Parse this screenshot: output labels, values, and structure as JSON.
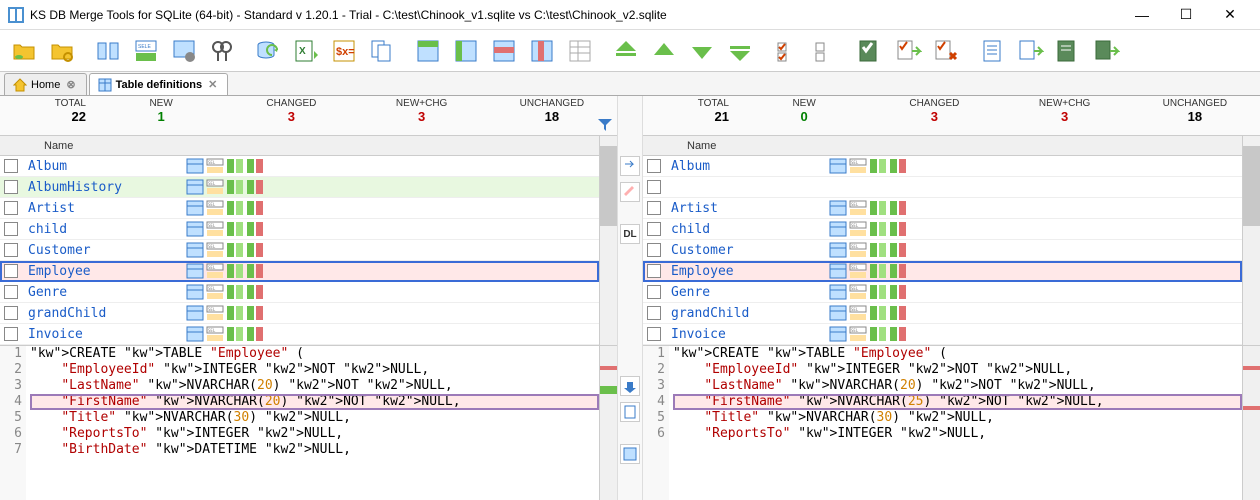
{
  "window": {
    "title": "KS DB Merge Tools for SQLite (64-bit) - Standard v 1.20.1 - Trial - C:\\test\\Chinook_v1.sqlite vs C:\\test\\Chinook_v2.sqlite"
  },
  "tabs": {
    "home": "Home",
    "active": "Table definitions"
  },
  "summary_labels": {
    "total": "TOTAL",
    "new": "NEW",
    "changed": "CHANGED",
    "newchg": "NEW+CHG",
    "unchanged": "UNCHANGED"
  },
  "left": {
    "summary": {
      "total": "22",
      "new": "1",
      "changed": "3",
      "newchg": "3",
      "unchanged": "18"
    },
    "col_name": "Name",
    "rows": [
      {
        "name": "Album",
        "state": ""
      },
      {
        "name": "AlbumHistory",
        "state": "new"
      },
      {
        "name": "Artist",
        "state": ""
      },
      {
        "name": "child",
        "state": ""
      },
      {
        "name": "Customer",
        "state": ""
      },
      {
        "name": "Employee",
        "state": "changed selected"
      },
      {
        "name": "Genre",
        "state": ""
      },
      {
        "name": "grandChild",
        "state": ""
      },
      {
        "name": "Invoice",
        "state": ""
      }
    ],
    "ddl": [
      "CREATE TABLE \"Employee\" (",
      "    \"EmployeeId\" INTEGER NOT NULL,",
      "    \"LastName\" NVARCHAR(20) NOT NULL,",
      "    \"FirstName\" NVARCHAR(20) NOT NULL,",
      "    \"Title\" NVARCHAR(30) NULL,",
      "    \"ReportsTo\" INTEGER NULL,",
      "    \"BirthDate\" DATETIME NULL,"
    ]
  },
  "right": {
    "summary": {
      "total": "21",
      "new": "0",
      "changed": "3",
      "newchg": "3",
      "unchanged": "18"
    },
    "col_name": "Name",
    "rows": [
      {
        "name": "Album",
        "state": ""
      },
      {
        "name": "",
        "state": "blank"
      },
      {
        "name": "Artist",
        "state": ""
      },
      {
        "name": "child",
        "state": ""
      },
      {
        "name": "Customer",
        "state": ""
      },
      {
        "name": "Employee",
        "state": "changed selected"
      },
      {
        "name": "Genre",
        "state": ""
      },
      {
        "name": "grandChild",
        "state": ""
      },
      {
        "name": "Invoice",
        "state": ""
      }
    ],
    "ddl": [
      "CREATE TABLE \"Employee\" (",
      "    \"EmployeeId\" INTEGER NOT NULL,",
      "    \"LastName\" NVARCHAR(20) NOT NULL,",
      "    \"FirstName\" NVARCHAR(25) NOT NULL,",
      "    \"Title\" NVARCHAR(30) NULL,",
      "    \"ReportsTo\" INTEGER NULL,"
    ]
  },
  "mid": {
    "dl": "DL"
  },
  "diff_line_index": 3
}
